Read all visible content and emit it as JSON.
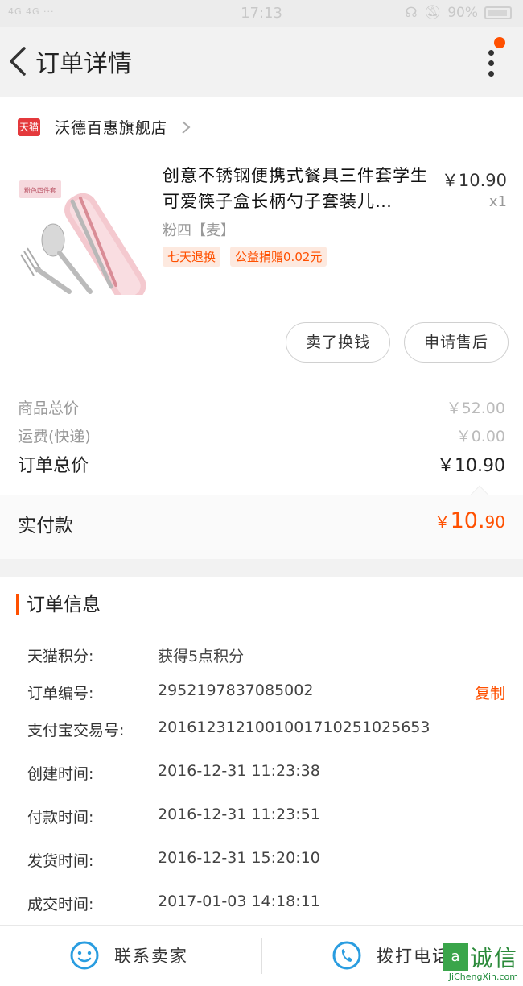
{
  "status_bar": {
    "left": "4G 4G ···",
    "time": "17:13",
    "battery": "90%"
  },
  "header": {
    "title": "订单详情"
  },
  "shop": {
    "badge": "天猫",
    "name": "沃德百惠旗舰店"
  },
  "product": {
    "title": "创意不锈钢便携式餐具三件套学生可爱筷子盒长柄勺子套装儿…",
    "sku": "粉四【麦】",
    "price": "￥10.90",
    "qty": "x1",
    "tags": [
      "七天退换",
      "公益捐赠0.02元"
    ],
    "thumb_label": "粉色四件套"
  },
  "actions": {
    "sell": "卖了换钱",
    "after_sale": "申请售后"
  },
  "summary": {
    "goods_total_label": "商品总价",
    "goods_total_value": "￥52.00",
    "shipping_label": "运费(快递)",
    "shipping_value": "￥0.00",
    "order_total_label": "订单总价",
    "order_total_value": "￥10.90",
    "paid_label": "实付款",
    "paid_currency": "￥",
    "paid_int": "10.",
    "paid_dec": "90"
  },
  "order_info": {
    "title": "订单信息",
    "rows": [
      {
        "key": "天猫积分:",
        "value": "获得5点积分"
      },
      {
        "key": "订单编号:",
        "value": "2952197837085002"
      },
      {
        "key": "支付宝交易号:",
        "value": "2016123121001001710251025653"
      },
      {
        "key": "创建时间:",
        "value": "2016-12-31 11:23:38"
      },
      {
        "key": "付款时间:",
        "value": "2016-12-31 11:23:51"
      },
      {
        "key": "发货时间:",
        "value": "2016-12-31 15:20:10"
      },
      {
        "key": "成交时间:",
        "value": "2017-01-03 14:18:11"
      }
    ],
    "copy_label": "复制"
  },
  "bottom_bar": {
    "contact_seller": "联系卖家",
    "call_phone": "拨打电话"
  },
  "watermark": {
    "logo": "a",
    "text": "诚信",
    "url": "JiChengXin.com"
  },
  "colors": {
    "accent": "#ff5000",
    "tmall": "#e4393c",
    "blue": "#2a9de0"
  },
  "icons": [
    "back-arrow-icon",
    "more-vertical-icon",
    "notification-dot",
    "tmall-logo-icon",
    "chevron-right-icon",
    "chat-icon",
    "phone-icon"
  ]
}
